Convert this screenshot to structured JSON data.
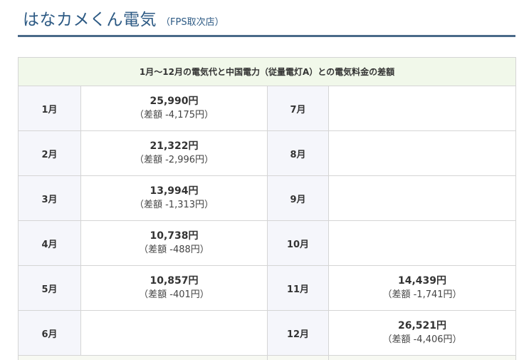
{
  "header": {
    "title": "はなカメくん電気",
    "subtitle": "（FPS取次店）"
  },
  "table": {
    "caption": "1月～12月の電気代と中国電力（従量電灯A）との電気料金の差額",
    "left": [
      {
        "month": "1月",
        "amount": "25,990円",
        "diff": "（差額 -4,175円）"
      },
      {
        "month": "2月",
        "amount": "21,322円",
        "diff": "（差額 -2,996円）"
      },
      {
        "month": "3月",
        "amount": "13,994円",
        "diff": "（差額 -1,313円）"
      },
      {
        "month": "4月",
        "amount": "10,738円",
        "diff": "（差額 -488円）"
      },
      {
        "month": "5月",
        "amount": "10,857円",
        "diff": "（差額 -401円）"
      },
      {
        "month": "6月",
        "amount": "",
        "diff": ""
      }
    ],
    "right": [
      {
        "month": "7月",
        "amount": "",
        "diff": ""
      },
      {
        "month": "8月",
        "amount": "",
        "diff": ""
      },
      {
        "month": "9月",
        "amount": "",
        "diff": ""
      },
      {
        "month": "10月",
        "amount": "",
        "diff": ""
      },
      {
        "month": "11月",
        "amount": "14,439円",
        "diff": "（差額 -1,741円）"
      },
      {
        "month": "12月",
        "amount": "26,521円",
        "diff": "（差額 -4,406円）"
      }
    ]
  }
}
